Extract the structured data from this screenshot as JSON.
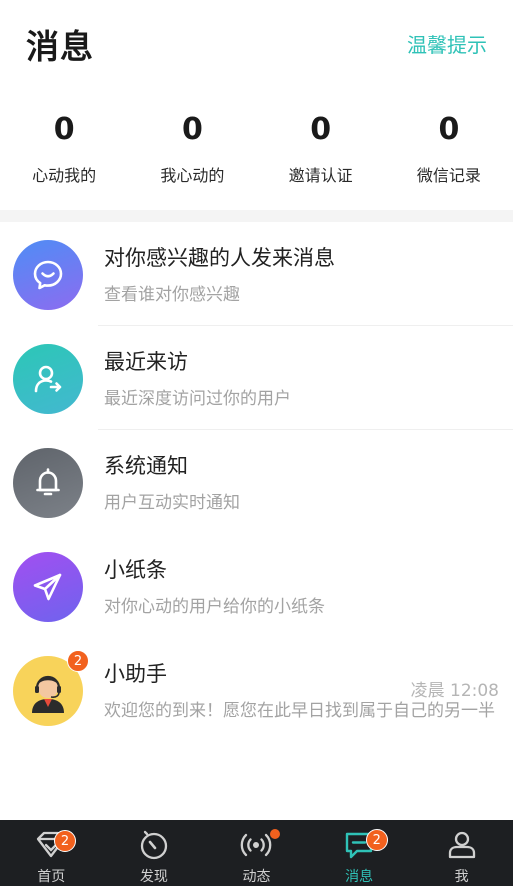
{
  "header": {
    "title": "消息",
    "tip_link": "温馨提示"
  },
  "stats": [
    {
      "value": "0",
      "label": "心动我的"
    },
    {
      "value": "0",
      "label": "我心动的"
    },
    {
      "value": "0",
      "label": "邀请认证"
    },
    {
      "value": "0",
      "label": "微信记录"
    }
  ],
  "list": [
    {
      "title": "对你感兴趣的人发来消息",
      "sub": "查看谁对你感兴趣",
      "icon": "chat-bubble-icon",
      "color": "#6a7df0"
    },
    {
      "title": "最近来访",
      "sub": "最近深度访问过你的用户",
      "icon": "visitor-icon",
      "color": "#2fc2b7"
    },
    {
      "title": "系统通知",
      "sub": "用户互动实时通知",
      "icon": "bell-icon",
      "color": "#6c7178"
    },
    {
      "title": "小纸条",
      "sub": "对你心动的用户给你的小纸条",
      "icon": "paper-plane-icon",
      "color": "#8e55ee"
    },
    {
      "title": "小助手",
      "sub": "欢迎您的到来！愿您在此早日找到属于自己的另一半",
      "time": "凌晨 12:08",
      "badge": "2",
      "icon": "assistant-avatar-icon",
      "color": "#f8d35a"
    }
  ],
  "tabs": [
    {
      "label": "首页",
      "icon": "heart-diamond-icon",
      "badge": "2"
    },
    {
      "label": "发现",
      "icon": "compass-icon"
    },
    {
      "label": "动态",
      "icon": "broadcast-icon",
      "dot": true
    },
    {
      "label": "消息",
      "icon": "message-icon",
      "badge": "2",
      "active": true
    },
    {
      "label": "我",
      "icon": "person-icon"
    }
  ],
  "colors": {
    "accent": "#2fc2b7",
    "badge": "#f2611e",
    "tabbar_bg": "#1d1f22"
  }
}
